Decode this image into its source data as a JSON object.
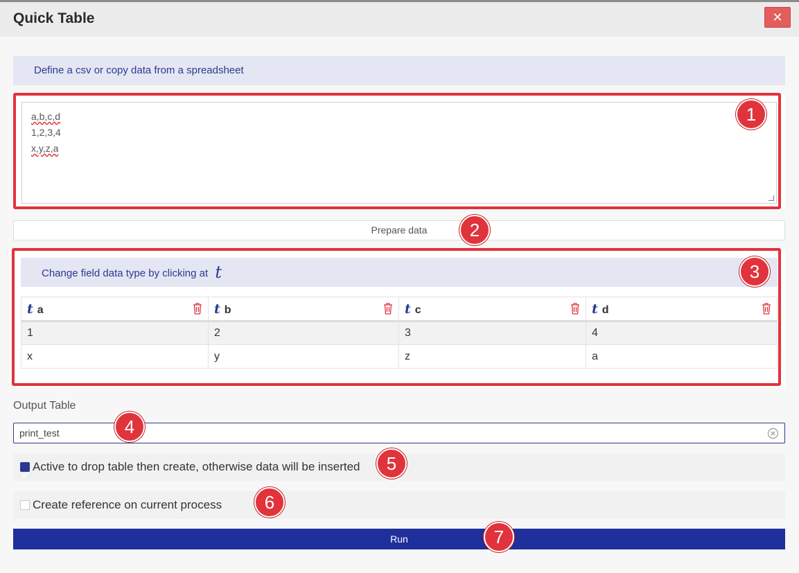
{
  "window": {
    "title": "Quick Table",
    "close_label": "✕"
  },
  "csv_section": {
    "info": "Define a csv or copy data from a spreadsheet",
    "lines": [
      "a,b,c,d",
      "1,2,3,4",
      "x,y,z,a"
    ]
  },
  "prepare_button": "Prepare data",
  "fields_section": {
    "info": "Change field data type by clicking at",
    "type_symbol": "t",
    "columns": [
      {
        "type": "t",
        "name": "a"
      },
      {
        "type": "t",
        "name": "b"
      },
      {
        "type": "t",
        "name": "c"
      },
      {
        "type": "t",
        "name": "d"
      }
    ],
    "rows": [
      [
        "1",
        "2",
        "3",
        "4"
      ],
      [
        "x",
        "y",
        "z",
        "a"
      ]
    ]
  },
  "output": {
    "label": "Output Table",
    "value": "print_test"
  },
  "options": {
    "drop_label": "Active to drop table then create, otherwise data will be inserted",
    "drop_checked": true,
    "reference_label": "Create reference on current process",
    "reference_checked": false
  },
  "run_button": "Run",
  "callouts": [
    "1",
    "2",
    "3",
    "4",
    "5",
    "6",
    "7"
  ],
  "colors": {
    "accent": "#1f2f9c",
    "callout": "#e0333c",
    "info_band": "#e4e6f3"
  }
}
